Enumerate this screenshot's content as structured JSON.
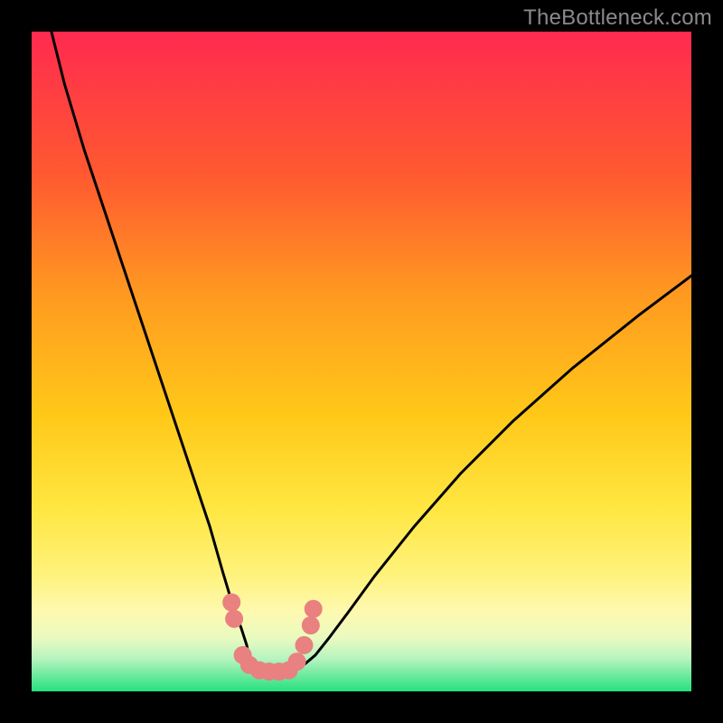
{
  "watermark": "TheBottleneck.com",
  "colors": {
    "frame": "#000000",
    "grad_top": "#ff2a50",
    "grad_a": "#ff5a30",
    "grad_b": "#ff9a20",
    "grad_c": "#ffc818",
    "grad_d": "#ffe640",
    "grad_e": "#fff27a",
    "grad_f": "#fdf9b0",
    "grad_g": "#e9fac0",
    "grad_h": "#b7f4c0",
    "grad_bottom": "#27e07e",
    "curve": "#000000",
    "marker": "#e8817f"
  },
  "chart_data": {
    "type": "line",
    "title": "",
    "xlabel": "",
    "ylabel": "",
    "xlim": [
      0,
      100
    ],
    "ylim": [
      0,
      100
    ],
    "series": [
      {
        "name": "left-curve",
        "x": [
          3,
          5,
          8,
          12,
          16,
          20,
          24,
          27,
          29,
          30.5,
          31.8,
          32.6,
          33,
          34,
          35.5,
          38
        ],
        "y": [
          100,
          92,
          82,
          70,
          58,
          46,
          34,
          25,
          18,
          13,
          9.5,
          7,
          5,
          3.8,
          3.2,
          3
        ]
      },
      {
        "name": "right-curve",
        "x": [
          38,
          40,
          41.5,
          43,
          45,
          48,
          52,
          58,
          65,
          73,
          82,
          92,
          100
        ],
        "y": [
          3,
          3.4,
          4.2,
          5.5,
          8,
          12,
          17.5,
          25,
          33,
          41,
          49,
          57,
          63
        ]
      }
    ],
    "markers": {
      "name": "data-points",
      "x": [
        30.3,
        30.7,
        32.0,
        33.0,
        34.5,
        36.0,
        37.5,
        39.0,
        40.2,
        41.3,
        42.3,
        42.7
      ],
      "y": [
        13.5,
        11.0,
        5.5,
        4.0,
        3.2,
        3.0,
        3.0,
        3.2,
        4.5,
        7.0,
        10.0,
        12.5
      ]
    }
  }
}
